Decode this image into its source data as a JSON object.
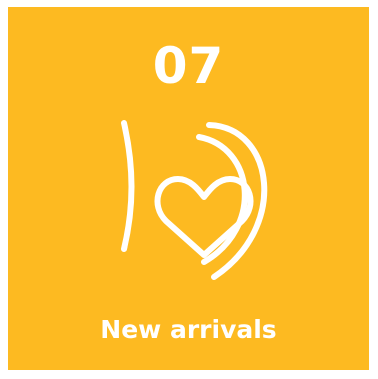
{
  "tile": {
    "number": "07",
    "label": "New arrivals",
    "icon": "hug-heart-icon",
    "colors": {
      "background": "#FDBA21",
      "foreground": "#FFFFFF"
    }
  }
}
